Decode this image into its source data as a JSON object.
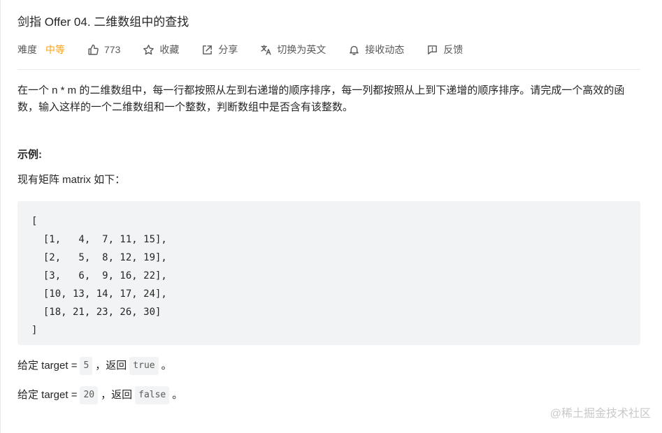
{
  "problem": {
    "title": "剑指 Offer 04. 二维数组中的查找",
    "difficulty_label": "难度",
    "difficulty": "中等",
    "likes": "773",
    "favorite_label": "收藏",
    "share_label": "分享",
    "translate_label": "切换为英文",
    "notify_label": "接收动态",
    "feedback_label": "反馈"
  },
  "description": "在一个 n * m 的二维数组中，每一行都按照从左到右递增的顺序排序，每一列都按照从上到下递增的顺序排序。请完成一个高效的函数，输入这样的一个二维数组和一个整数，判断数组中是否含有该整数。",
  "example": {
    "title": "示例:",
    "intro": "现有矩阵 matrix 如下：",
    "code_lines": [
      "[",
      "  [1,   4,  7, 11, 15],",
      "  [2,   5,  8, 12, 19],",
      "  [3,   6,  9, 16, 22],",
      "  [10, 13, 14, 17, 24],",
      "  [18, 21, 23, 26, 30]",
      "]"
    ],
    "case1": {
      "prefix": "给定 target =",
      "target": "5",
      "middle": "，返回",
      "result": "true",
      "suffix": "。"
    },
    "case2": {
      "prefix": "给定 target =",
      "target": "20",
      "middle": "，返回",
      "result": "false",
      "suffix": "。"
    }
  },
  "watermark": "@稀土掘金技术社区",
  "colors": {
    "difficulty_medium": "#ffa116",
    "code_bg": "#f2f3f4"
  }
}
